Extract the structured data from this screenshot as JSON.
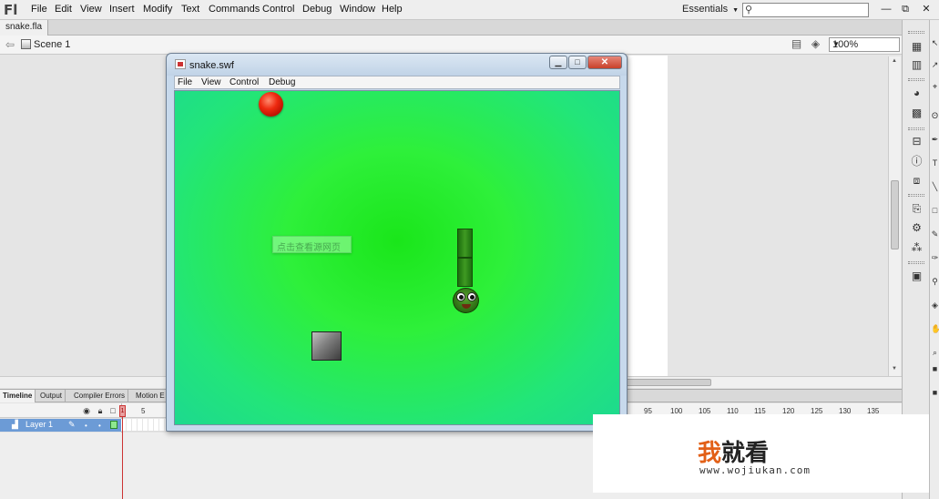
{
  "app": {
    "logo": "Fl",
    "menu": [
      "File",
      "Edit",
      "View",
      "Insert",
      "Modify",
      "Text",
      "Commands",
      "Control",
      "Debug",
      "Window",
      "Help"
    ],
    "workspace": "Essentials",
    "search_placeholder": "",
    "window_controls": [
      "—",
      "⧉",
      "✕"
    ]
  },
  "document": {
    "tab": "snake.fla",
    "scene": "Scene 1",
    "zoom": "100%"
  },
  "swf_window": {
    "title": "snake.swf",
    "menu": [
      "File",
      "View",
      "Control",
      "Debug"
    ],
    "buttons": [
      "▁",
      "□",
      "✕"
    ],
    "overlay_button_text": "点击查看源网页"
  },
  "timeline": {
    "tabs": [
      "Timeline",
      "Output",
      "Compiler Errors",
      "Motion E"
    ],
    "frame_numbers_left": [
      "1",
      "5"
    ],
    "frame_numbers_right": [
      "95",
      "100",
      "105",
      "110",
      "115",
      "120",
      "125",
      "130",
      "135"
    ],
    "layer_name": "Layer 1"
  },
  "brand": {
    "chinese_1": "我",
    "chinese_2": "就看",
    "url": "www.wojiukan.com"
  },
  "colors": {
    "stage_green": "#22e550",
    "layer_highlight": "#6c9bd6",
    "playhead": "#cc3333",
    "ball_red": "#ee2a10",
    "brand_orange": "#e26017"
  }
}
